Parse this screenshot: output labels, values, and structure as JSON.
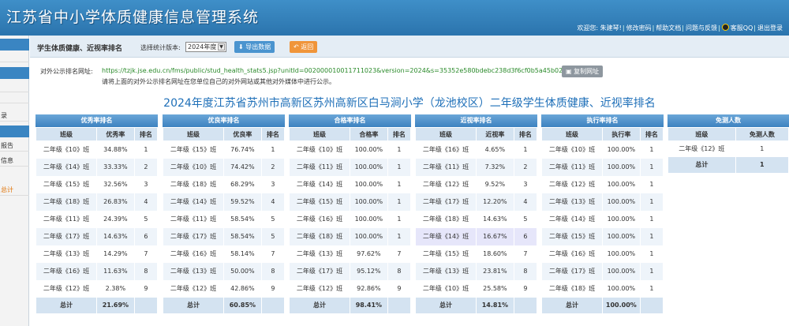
{
  "app": {
    "title": "江苏省中小学体质健康信息管理系统",
    "links": [
      "欢迎您: 朱建琴!",
      "修改密码",
      "帮助文档",
      "问题与反馈",
      "客服QQ",
      "退出登录"
    ]
  },
  "sidebar": {
    "items": [
      "",
      "",
      "",
      "",
      "",
      "",
      "",
      "",
      "",
      "",
      "",
      "",
      "",
      "",
      "",
      "",
      "",
      "",
      "",
      "",
      "",
      "",
      "",
      ""
    ],
    "visible_fragments": [
      "",
      "录",
      "报告",
      "信息",
      "总计"
    ]
  },
  "toolbar": {
    "page_title": "学生体质健康、近视率排名",
    "version_label": "选择统计版本:",
    "version_value": "2024年度",
    "export_label": "导出数据",
    "back_label": "返回"
  },
  "public_url": {
    "label": "对外公示排名网址:",
    "value": "https://tzjk.jse.edu.cn/fms/public/stud_health_stats5.jsp?unitId=002000010011711023&version=2024&s=35352e580bdebc238d3f6cf0b5a45b02",
    "copy_label": "复制网址",
    "hint": "请将上面的对外公示排名网址在您单位自己的对外网站或其他对外媒体中进行公示。"
  },
  "report_title": "2024年度江苏省苏州市高新区苏州高新区白马涧小学（龙池校区）二年级学生体质健康、近视率排名",
  "panels": [
    {
      "title": "优秀率排名",
      "headers": [
        "班级",
        "优秀率",
        "排名"
      ],
      "rows": [
        [
          "二年级《10》班",
          "34.88%",
          "1"
        ],
        [
          "二年级《14》班",
          "33.33%",
          "2"
        ],
        [
          "二年级《15》班",
          "32.56%",
          "3"
        ],
        [
          "二年级《18》班",
          "26.83%",
          "4"
        ],
        [
          "二年级《11》班",
          "24.39%",
          "5"
        ],
        [
          "二年级《17》班",
          "14.63%",
          "6"
        ],
        [
          "二年级《13》班",
          "14.29%",
          "7"
        ],
        [
          "二年级《16》班",
          "11.63%",
          "8"
        ],
        [
          "二年级《12》班",
          "2.38%",
          "9"
        ]
      ],
      "total": [
        "总计",
        "21.69%",
        ""
      ]
    },
    {
      "title": "优良率排名",
      "headers": [
        "班级",
        "优良率",
        "排名"
      ],
      "rows": [
        [
          "二年级《15》班",
          "76.74%",
          "1"
        ],
        [
          "二年级《10》班",
          "74.42%",
          "2"
        ],
        [
          "二年级《18》班",
          "68.29%",
          "3"
        ],
        [
          "二年级《14》班",
          "59.52%",
          "4"
        ],
        [
          "二年级《11》班",
          "58.54%",
          "5"
        ],
        [
          "二年级《17》班",
          "58.54%",
          "5"
        ],
        [
          "二年级《16》班",
          "58.14%",
          "7"
        ],
        [
          "二年级《13》班",
          "50.00%",
          "8"
        ],
        [
          "二年级《12》班",
          "42.86%",
          "9"
        ]
      ],
      "total": [
        "总计",
        "60.85%",
        ""
      ]
    },
    {
      "title": "合格率排名",
      "headers": [
        "班级",
        "合格率",
        "排名"
      ],
      "rows": [
        [
          "二年级《10》班",
          "100.00%",
          "1"
        ],
        [
          "二年级《11》班",
          "100.00%",
          "1"
        ],
        [
          "二年级《14》班",
          "100.00%",
          "1"
        ],
        [
          "二年级《15》班",
          "100.00%",
          "1"
        ],
        [
          "二年级《16》班",
          "100.00%",
          "1"
        ],
        [
          "二年级《18》班",
          "100.00%",
          "1"
        ],
        [
          "二年级《13》班",
          "97.62%",
          "7"
        ],
        [
          "二年级《17》班",
          "95.12%",
          "8"
        ],
        [
          "二年级《12》班",
          "92.86%",
          "9"
        ]
      ],
      "total": [
        "总计",
        "98.41%",
        ""
      ]
    },
    {
      "title": "近视率排名",
      "headers": [
        "班级",
        "近视率",
        "排名"
      ],
      "rows": [
        [
          "二年级《16》班",
          "4.65%",
          "1"
        ],
        [
          "二年级《11》班",
          "7.32%",
          "2"
        ],
        [
          "二年级《12》班",
          "9.52%",
          "3"
        ],
        [
          "二年级《17》班",
          "12.20%",
          "4"
        ],
        [
          "二年级《18》班",
          "14.63%",
          "5"
        ],
        [
          "二年级《14》班",
          "16.67%",
          "6"
        ],
        [
          "二年级《15》班",
          "18.60%",
          "7"
        ],
        [
          "二年级《13》班",
          "23.81%",
          "8"
        ],
        [
          "二年级《10》班",
          "25.58%",
          "9"
        ]
      ],
      "total": [
        "总计",
        "14.81%",
        ""
      ]
    },
    {
      "title": "执行率排名",
      "headers": [
        "班级",
        "执行率",
        "排名"
      ],
      "rows": [
        [
          "二年级《10》班",
          "100.00%",
          "1"
        ],
        [
          "二年级《11》班",
          "100.00%",
          "1"
        ],
        [
          "二年级《12》班",
          "100.00%",
          "1"
        ],
        [
          "二年级《13》班",
          "100.00%",
          "1"
        ],
        [
          "二年级《14》班",
          "100.00%",
          "1"
        ],
        [
          "二年级《15》班",
          "100.00%",
          "1"
        ],
        [
          "二年级《16》班",
          "100.00%",
          "1"
        ],
        [
          "二年级《17》班",
          "100.00%",
          "1"
        ],
        [
          "二年级《18》班",
          "100.00%",
          "1"
        ]
      ],
      "total": [
        "总计",
        "100.00%",
        ""
      ]
    },
    {
      "title": "免测人数",
      "headers": [
        "班级",
        "免测人数"
      ],
      "rows": [
        [
          "二年级《12》班",
          "1"
        ]
      ],
      "total": [
        "总计",
        "1"
      ]
    }
  ],
  "colors": {
    "header_blue": "#3f8fc8",
    "title_blue": "#1e6fb8",
    "url_green": "#2a8a2a",
    "back_orange": "#f0953a",
    "highlight_row": "#e6e6fa"
  }
}
